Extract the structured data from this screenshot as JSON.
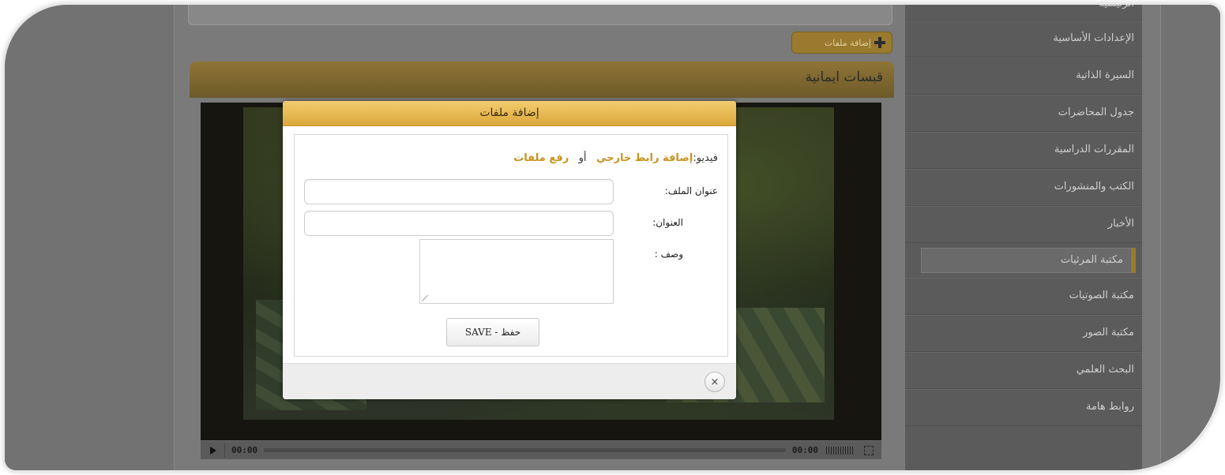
{
  "top_bar": {
    "add_files_label": "إضافة ملفات"
  },
  "section": {
    "title": "قبسات ايمانية"
  },
  "player": {
    "current_time": "00:00",
    "duration": "00:00",
    "progress": 0
  },
  "sidebar": {
    "items": [
      {
        "label": "الرئيسية"
      },
      {
        "label": "الإعدادات الأساسية"
      },
      {
        "label": "السيرة الذاتية"
      },
      {
        "label": "جدول المحاضرات"
      },
      {
        "label": "المقررات الدراسية"
      },
      {
        "label": "الكتب والمنشورات"
      },
      {
        "label": "الأخبار"
      },
      {
        "label": "مكتبة المرئيات"
      },
      {
        "label": "مكتبة الصوتيات"
      },
      {
        "label": "مكتبة الصور"
      },
      {
        "label": "البحث العلمي"
      },
      {
        "label": "روابط هامة"
      }
    ],
    "active_index": 7
  },
  "modal": {
    "title": "إضافة ملفات",
    "video_label": "فيديو:",
    "external_link_label": "إضافة رابط خارجي",
    "or_label": "أو",
    "upload_label": "رفع ملفات",
    "file_title_label": "عنوان الملف:",
    "file_title_value": "",
    "title_label": "العنوان:",
    "title_value": "",
    "description_label": "وصف :",
    "description_value": "",
    "save_label": "حفظ - SAVE",
    "close_symbol": "×"
  },
  "colors": {
    "accent": "#dba83a",
    "link": "#c8921e",
    "overlay": "#727272"
  }
}
